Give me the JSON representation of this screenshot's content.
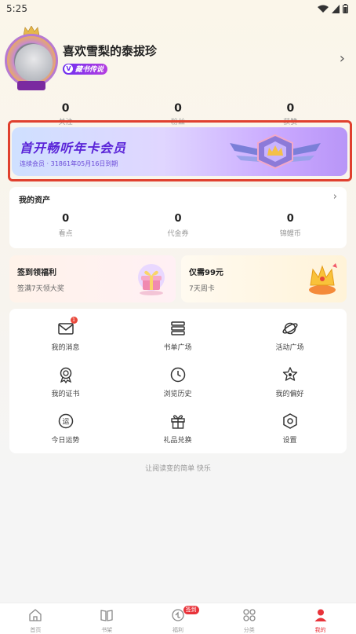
{
  "status_bar": {
    "time": "5:25"
  },
  "profile": {
    "name": "喜欢雪梨的泰拔珍",
    "vip_level": "藏书传说"
  },
  "stats": [
    {
      "value": "0",
      "label": "关注"
    },
    {
      "value": "0",
      "label": "粉丝"
    },
    {
      "value": "0",
      "label": "获赞"
    }
  ],
  "banner": {
    "title": "首开畅听年卡会员",
    "subtitle": "连续会员 · 31861年05月16日到期"
  },
  "assets": {
    "title": "我的资产",
    "items": [
      {
        "value": "0",
        "label": "看点"
      },
      {
        "value": "0",
        "label": "代金券"
      },
      {
        "value": "0",
        "label": "锦鲤币"
      }
    ]
  },
  "promos": {
    "left": {
      "title": "签到领福利",
      "subtitle": "签满7天领大奖"
    },
    "right": {
      "title": "仅需99元",
      "subtitle": "7天周卡"
    }
  },
  "menu": [
    {
      "label": "我的消息",
      "icon": "mail-icon",
      "badge": "1"
    },
    {
      "label": "书单广场",
      "icon": "book-stack-icon"
    },
    {
      "label": "活动广场",
      "icon": "planet-icon"
    },
    {
      "label": "我的证书",
      "icon": "medal-icon"
    },
    {
      "label": "浏览历史",
      "icon": "clock-icon"
    },
    {
      "label": "我的偏好",
      "icon": "star-badge-icon"
    },
    {
      "label": "今日运势",
      "icon": "fortune-icon"
    },
    {
      "label": "礼品兑换",
      "icon": "gift-icon"
    },
    {
      "label": "设置",
      "icon": "settings-icon"
    }
  ],
  "slogan": "让阅读变的简单 快乐",
  "bottom_nav": [
    {
      "label": "首页",
      "icon": "home-icon"
    },
    {
      "label": "书架",
      "icon": "bookshelf-icon"
    },
    {
      "label": "福利",
      "icon": "gift-nav-icon",
      "badge": "签到"
    },
    {
      "label": "分类",
      "icon": "category-icon"
    },
    {
      "label": "我的",
      "icon": "profile-icon",
      "active": true
    }
  ],
  "colors": {
    "accent": "#e8333a",
    "banner_purple": "#5a24d8",
    "outline_red": "#e0402e"
  }
}
